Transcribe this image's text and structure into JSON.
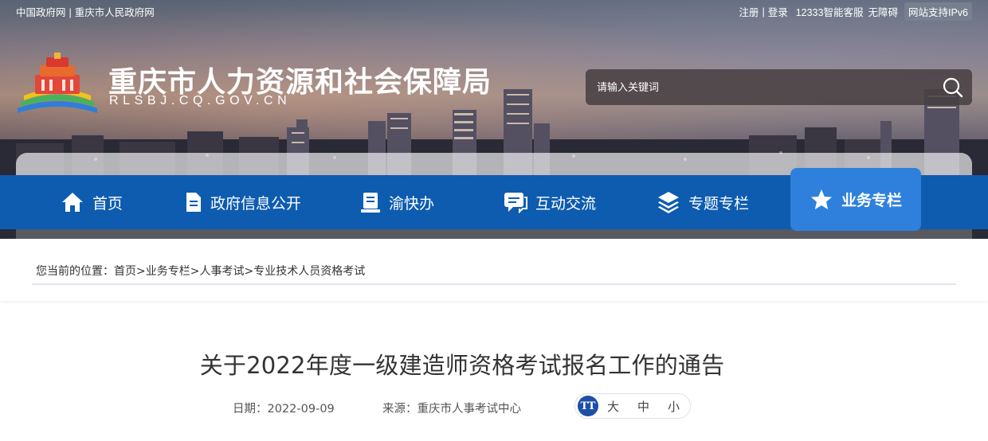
{
  "topbar": {
    "link_gov": "中国政府网",
    "link_cq": "重庆市人民政府网",
    "register": "注册",
    "login": "登录",
    "service": "12333智能客服",
    "accessibility": "无障碍",
    "ipv6": "网站支持IPv6"
  },
  "header": {
    "title": "重庆市人力资源和社会保障局",
    "domain": "RLSBJ.CQ.GOV.CN"
  },
  "search": {
    "placeholder": "请输入关键词"
  },
  "nav": {
    "items": [
      {
        "label": "首页",
        "icon": "home-icon"
      },
      {
        "label": "政府信息公开",
        "icon": "document-icon"
      },
      {
        "label": "渝快办",
        "icon": "clipboard-icon"
      },
      {
        "label": "互动交流",
        "icon": "chat-icon"
      },
      {
        "label": "专题专栏",
        "icon": "layers-icon"
      },
      {
        "label": "业务专栏",
        "icon": "star-icon",
        "active": true
      }
    ]
  },
  "breadcrumb": {
    "prefix": "您当前的位置：",
    "items": [
      "首页",
      "业务专栏",
      "人事考试",
      "专业技术人员资格考试"
    ],
    "separator": ">"
  },
  "article": {
    "title": "关于2022年度一级建造师资格考试报名工作的通告",
    "date_label": "日期：",
    "date": "2022-09-09",
    "source_label": "来源：",
    "source": "重庆市人事考试中心",
    "font_sizes": [
      "大",
      "中",
      "小"
    ]
  },
  "colors": {
    "nav_bg": "#0e5cb0",
    "nav_active": "#2f80dc",
    "font_icon": "#1e4ea8"
  }
}
